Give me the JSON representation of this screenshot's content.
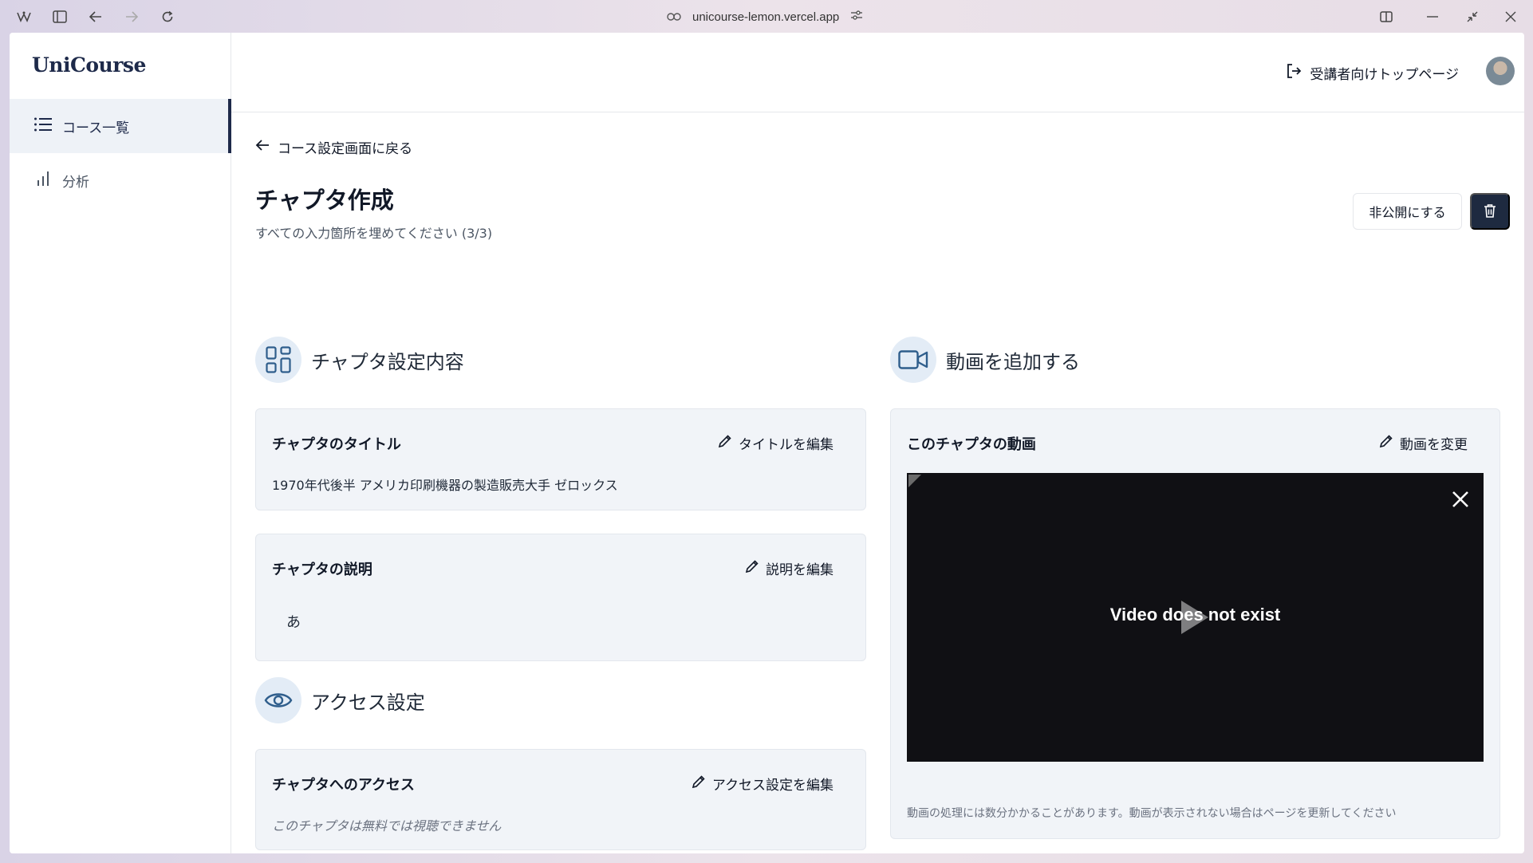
{
  "browser": {
    "url": "unicourse-lemon.vercel.app"
  },
  "sidebar": {
    "logo": "UniCourse",
    "items": [
      {
        "label": "コース一覧",
        "icon": "list-icon",
        "active": true
      },
      {
        "label": "分析",
        "icon": "bar-chart-icon",
        "active": false
      }
    ]
  },
  "header": {
    "top_link": "受講者向けトップページ"
  },
  "page": {
    "back_link": "コース設定画面に戻る",
    "title": "チャプタ作成",
    "subtitle": "すべての入力箇所を埋めてください (3/3)",
    "unpublish_button": "非公開にする",
    "delete_icon": "trash-icon"
  },
  "chapter_settings": {
    "heading": "チャプタ設定内容",
    "title_card": {
      "label": "チャプタのタイトル",
      "edit": "タイトルを編集",
      "value": "1970年代後半 アメリカ印刷機器の製造販売大手 ゼロックス"
    },
    "description_card": {
      "label": "チャプタの説明",
      "edit": "説明を編集",
      "value": "あ"
    }
  },
  "access_settings": {
    "heading": "アクセス設定",
    "card": {
      "label": "チャプタへのアクセス",
      "edit": "アクセス設定を編集",
      "value": "このチャプタは無料では視聴できません"
    }
  },
  "video_section": {
    "heading": "動画を追加する",
    "card": {
      "label": "このチャプタの動画",
      "edit": "動画を変更",
      "player_message": "Video does not exist",
      "note": "動画の処理には数分かかることがあります。動画が表示されない場合はページを更新してください"
    }
  },
  "colors": {
    "brand_dark": "#1e2a40",
    "icon_accent": "#2f5e8c",
    "card_bg": "#f1f4f8"
  }
}
